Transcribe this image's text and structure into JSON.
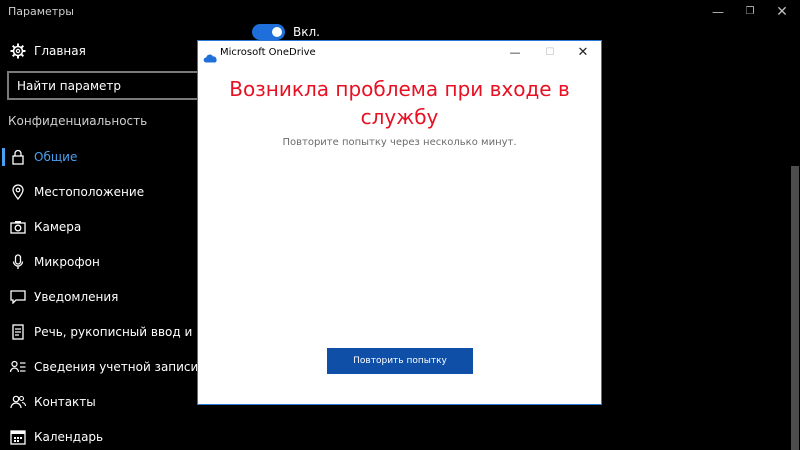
{
  "window": {
    "title": "Параметры",
    "min_glyph": "—",
    "max_glyph": "❐",
    "close_glyph": "✕"
  },
  "sidebar": {
    "home_label": "Главная",
    "search_placeholder": "Найти параметр",
    "section_title": "Конфиденциальность",
    "items": [
      {
        "label": "Общие",
        "icon": "lock-icon",
        "glyph": "🔒",
        "active": true
      },
      {
        "label": "Местоположение",
        "icon": "location-icon",
        "glyph": "⌖"
      },
      {
        "label": "Камера",
        "icon": "camera-icon",
        "glyph": "◙"
      },
      {
        "label": "Микрофон",
        "icon": "microphone-icon",
        "glyph": "🎙"
      },
      {
        "label": "Уведомления",
        "icon": "notification-icon",
        "glyph": "☐"
      },
      {
        "label": "Речь, рукописный ввод и ввод т",
        "icon": "speech-icon",
        "glyph": "☷"
      },
      {
        "label": "Сведения учетной записи",
        "icon": "account-info-icon",
        "glyph": "☰"
      },
      {
        "label": "Контакты",
        "icon": "contacts-icon",
        "glyph": "👥"
      },
      {
        "label": "Календарь",
        "icon": "calendar-icon",
        "glyph": "▦"
      }
    ]
  },
  "content": {
    "toggle_label": "Вкл.",
    "toggle_on": true
  },
  "dialog": {
    "title": "Microsoft OneDrive",
    "error_title": "Возникла проблема при входе в службу",
    "error_subtitle": "Повторите попытку через несколько минут.",
    "retry_label": "Повторить попытку",
    "min_glyph": "—",
    "max_glyph": "☐",
    "close_glyph": "✕"
  },
  "colors": {
    "accent": "#4aa0f0",
    "error": "#e81123",
    "button": "#0f4fa8",
    "toggle": "#1e6fd9"
  }
}
